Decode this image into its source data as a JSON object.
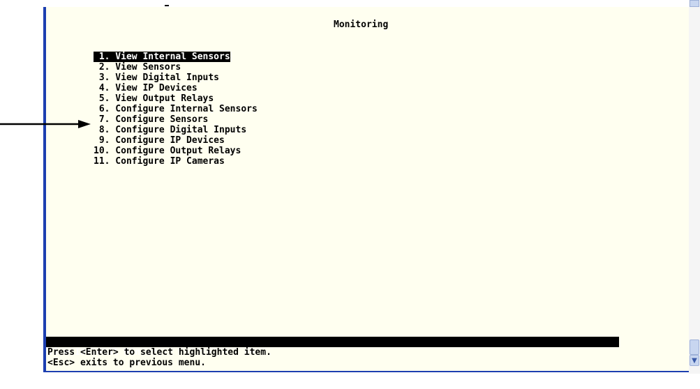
{
  "terminal": {
    "title": "Monitoring",
    "menu": [
      {
        "label": " 1. View Internal Sensors",
        "selected": true
      },
      {
        "label": " 2. View Sensors"
      },
      {
        "label": " 3. View Digital Inputs"
      },
      {
        "label": " 4. View IP Devices"
      },
      {
        "label": " 5. View Output Relays"
      },
      {
        "label": " 6. Configure Internal Sensors"
      },
      {
        "label": " 7. Configure Sensors"
      },
      {
        "label": " 8. Configure Digital Inputs"
      },
      {
        "label": " 9. Configure IP Devices"
      },
      {
        "label": "10. Configure Output Relays"
      },
      {
        "label": "11. Configure IP Cameras"
      }
    ],
    "status": {
      "highlighted_item": "View Internal Sensors",
      "help_enter": "Press <Enter> to select highlighted item.",
      "help_esc": "<Esc> exits to previous menu."
    }
  },
  "colors": {
    "terminal_bg": "#fffff0",
    "border": "#1d3fb0",
    "highlight": "#000000"
  },
  "icons": {
    "arrow": "arrow-right-icon",
    "scroll_down": "chevron-down-icon"
  }
}
